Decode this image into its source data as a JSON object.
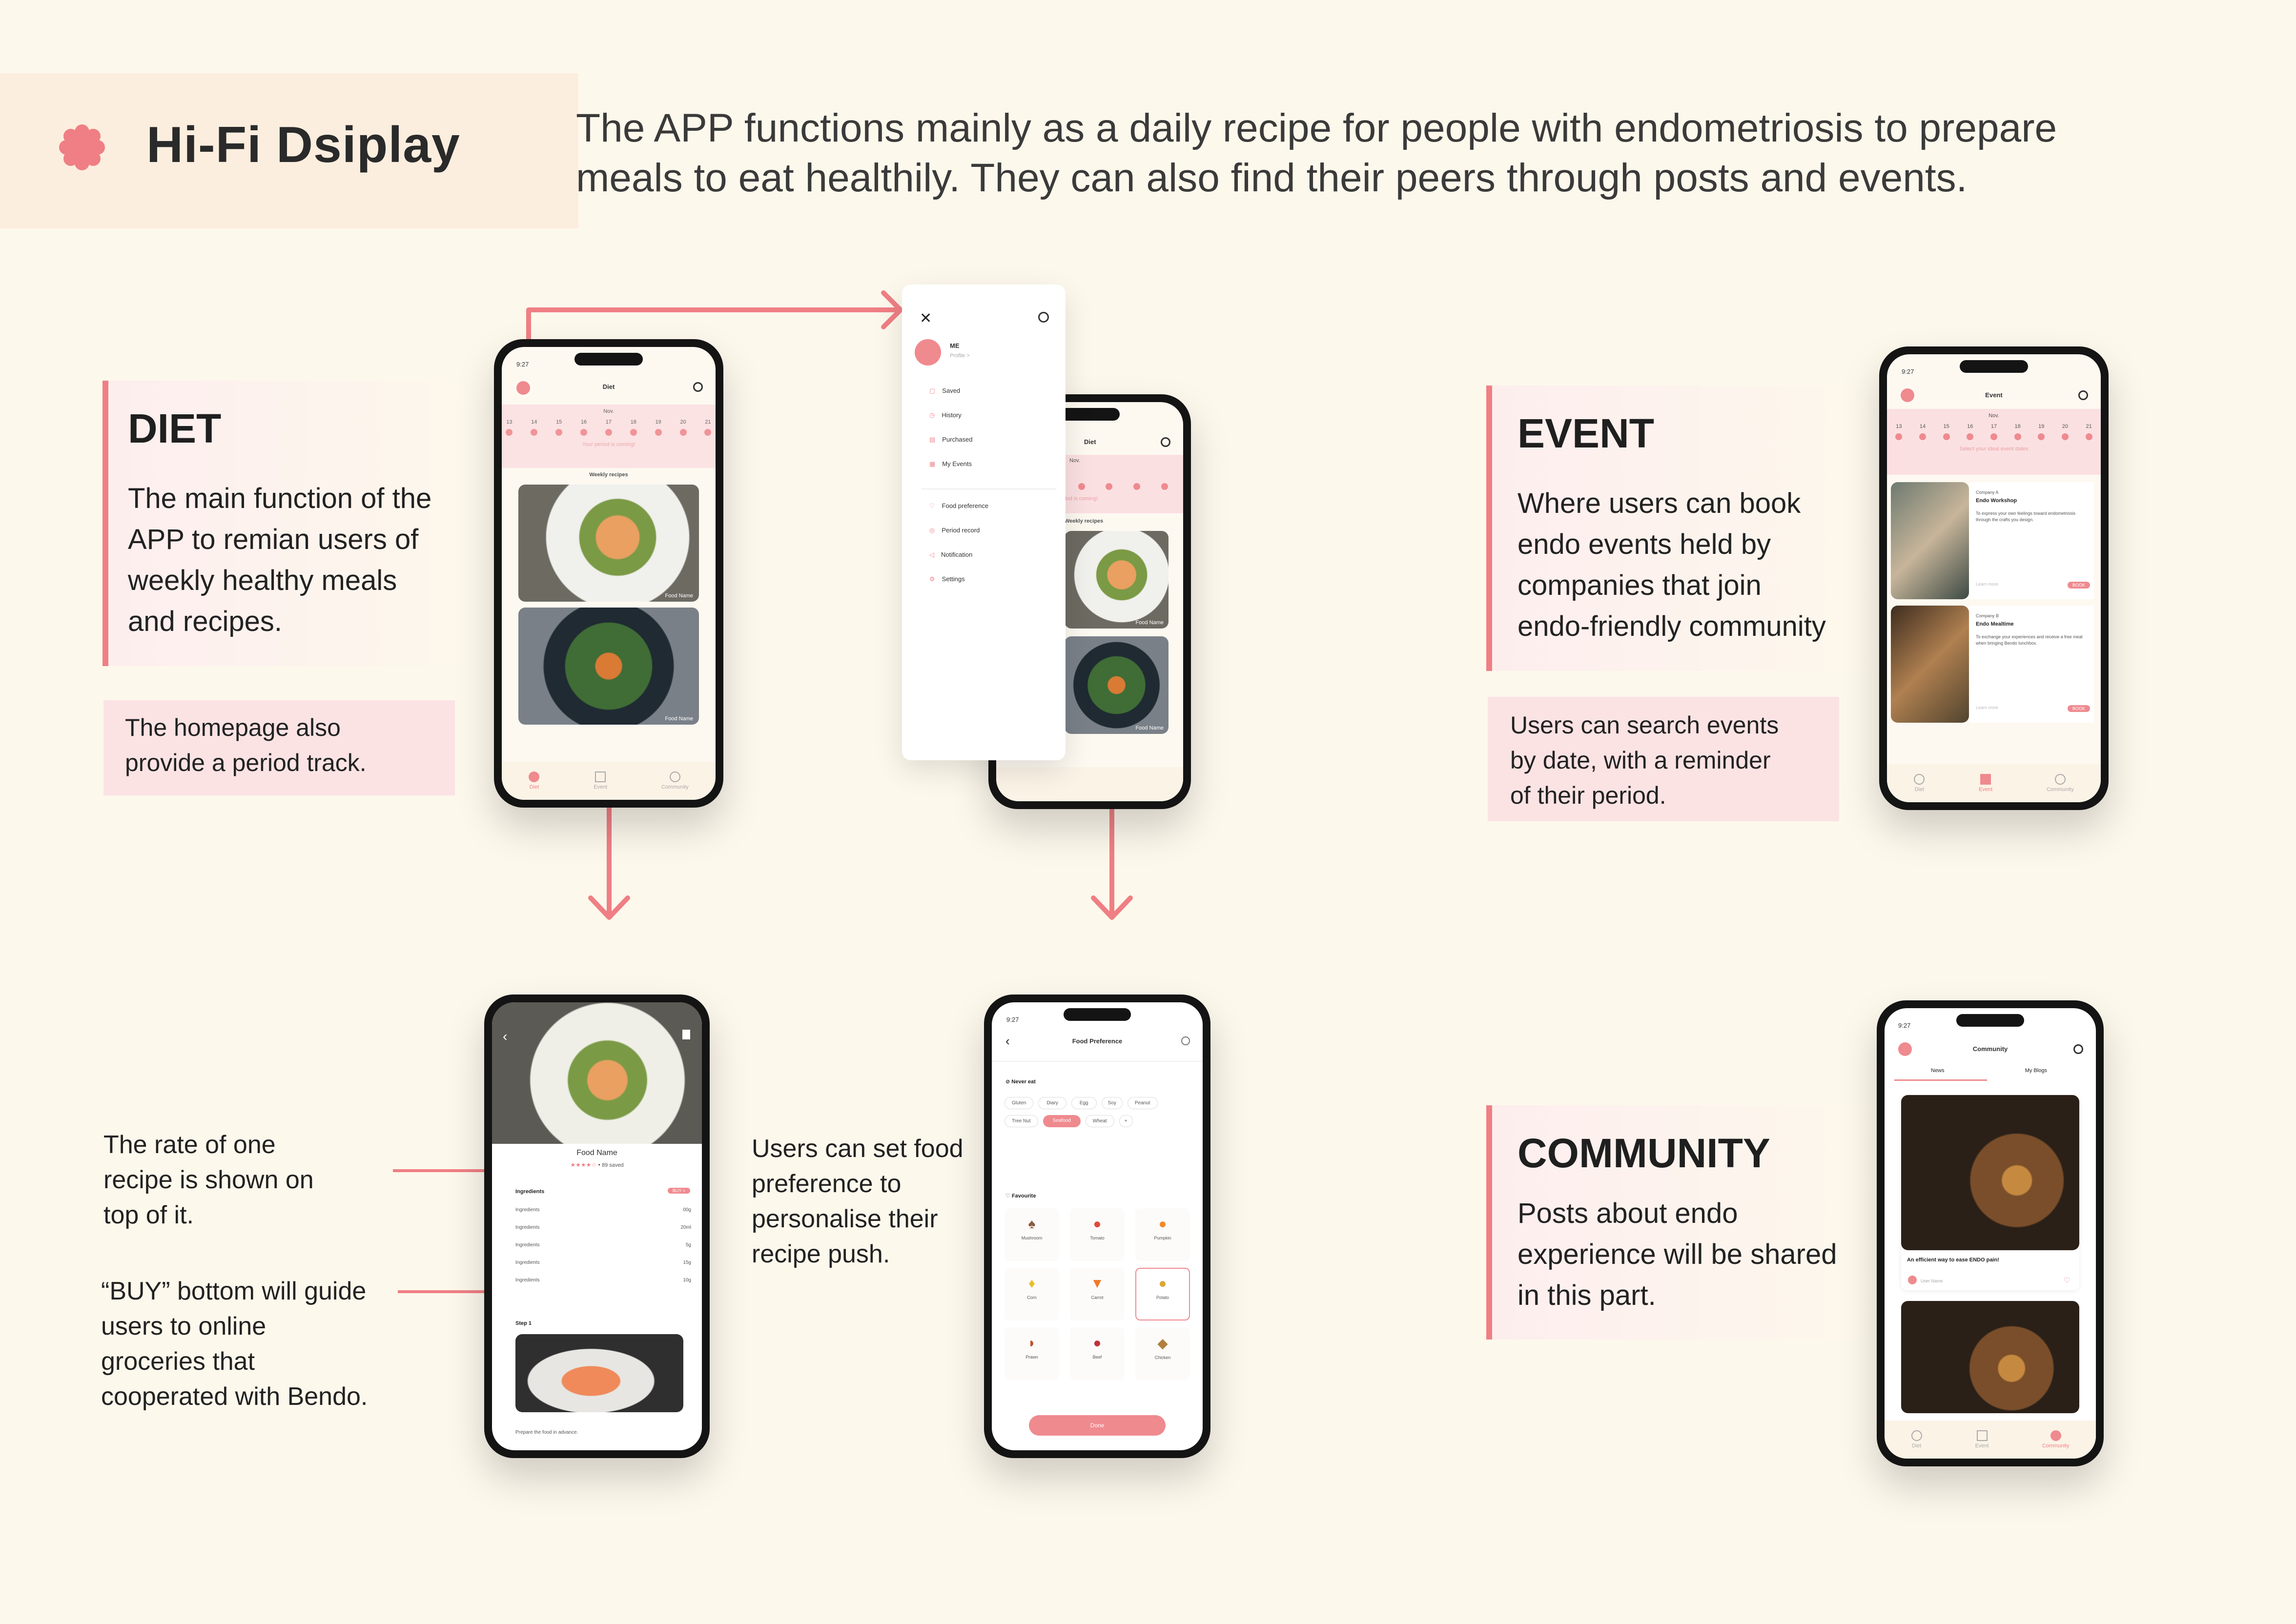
{
  "header": {
    "title": "Hi-Fi Dsiplay",
    "intro_line1": "The APP functions mainly as a daily recipe for people with endometriosis to prepare",
    "intro_line2": "meals to eat healthily. They can also find their peers through posts and events."
  },
  "diet": {
    "heading": "DIET",
    "body_l1": "The main function of the",
    "body_l2": "APP to remian users of",
    "body_l3": "weekly healthy meals",
    "body_l4": "and recipes.",
    "note_l1": "The homepage also",
    "note_l2": "provide a period track."
  },
  "event": {
    "heading": "EVENT",
    "body_l1": "Where users can book",
    "body_l2": "endo events held by",
    "body_l3": "companies that join",
    "body_l4": "endo-friendly community",
    "note_l1": "Users can search events",
    "note_l2": "by date, with a reminder",
    "note_l3": "of their period."
  },
  "community": {
    "heading": "COMMUNITY",
    "body_l1": "Posts about endo",
    "body_l2": "experience will be shared",
    "body_l3": "in this part."
  },
  "recipe_notes": {
    "rate_l1": "The rate of one",
    "rate_l2": "recipe is shown on",
    "rate_l3": "top of it.",
    "buy_l1": "“BUY” bottom will guide",
    "buy_l2": "users to online",
    "buy_l3": "groceries that",
    "buy_l4": "cooperated with Bendo."
  },
  "pref_note": {
    "l1": "Users can set food",
    "l2": "preference to",
    "l3": "personalise their",
    "l4": "recipe push."
  },
  "phone_common": {
    "time": "9:27",
    "days": [
      "13",
      "14",
      "15",
      "16",
      "17",
      "18",
      "19",
      "20",
      "21"
    ],
    "month": "Nov.",
    "tab_diet": "Diet",
    "tab_event": "Event",
    "tab_community": "Community"
  },
  "diet_screen": {
    "title": "Diet",
    "period_msg": "Your period is coming!",
    "weekly": "Weekly recipes",
    "food_name": "Food Name"
  },
  "menu": {
    "user": "ME",
    "profile": "Profile >",
    "items1": [
      "Saved",
      "History",
      "Purchased",
      "My Events"
    ],
    "items2": [
      "Food preference",
      "Period record",
      "Notification",
      "Settings"
    ]
  },
  "event_screen": {
    "title": "Event",
    "hint": "Select your ideal event dates",
    "e1_company": "Company A",
    "e1_title": "Endo Workshop",
    "e1_desc": "To express your own feelings toward endometriosis through the crafts you design.",
    "e2_company": "Company B",
    "e2_title": "Endo Mealtime",
    "e2_desc": "To exchange your experiences and receive a free meal when bringing Bendo lunchbox.",
    "learn": "Learn more",
    "book": "BOOK"
  },
  "recipe_screen": {
    "food_name": "Food Name",
    "saved": "89 saved",
    "ingredients": "Ingredients",
    "buy": "BUY >",
    "ing_items": [
      "Ingredients",
      "Ingredients",
      "Ingredients",
      "Ingredients",
      "Ingredients"
    ],
    "amounts": [
      "00g",
      "20ml",
      "5g",
      "15g",
      "10g"
    ],
    "step": "Step 1",
    "step_text": "Prepare the food in advance."
  },
  "pref_screen": {
    "title": "Food Preference",
    "never": "Never eat",
    "tags": [
      "Gluten",
      "Diary",
      "Egg",
      "Soy",
      "Peanut",
      "Tree Nut",
      "Seafood",
      "Wheat",
      "+"
    ],
    "favourite": "Favourite",
    "foods": [
      "Mushroom",
      "Tomato",
      "Pumpkin",
      "Corn",
      "Carrot",
      "Potato",
      "Prawn",
      "Beef",
      "Chicken"
    ],
    "done": "Done"
  },
  "community_screen": {
    "title": "Community",
    "tab_news": "News",
    "tab_blogs": "My Blogs",
    "post_title": "An efficient way to ease ENDO pain!",
    "user": "User Name"
  },
  "colors": {
    "accent": "#ef7f84",
    "card": "#fbe3e4",
    "bg": "#fdf8ec"
  }
}
